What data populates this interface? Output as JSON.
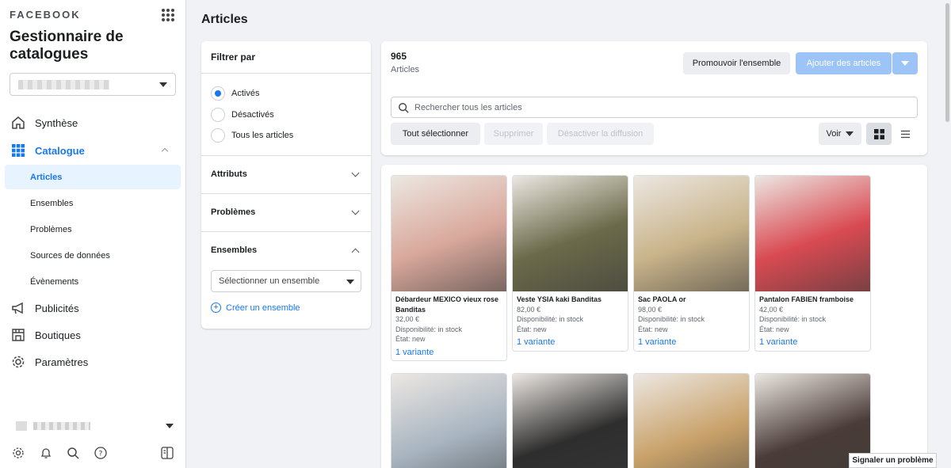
{
  "brand": "FACEBOOK",
  "app_title": "Gestionnaire de catalogues",
  "nav": {
    "synthese": "Synthèse",
    "catalogue": "Catalogue",
    "sub": [
      "Articles",
      "Ensembles",
      "Problèmes",
      "Sources de données",
      "Évènements"
    ],
    "publicites": "Publicités",
    "boutiques": "Boutiques",
    "parametres": "Paramètres"
  },
  "page_title": "Articles",
  "filter": {
    "title": "Filtrer par",
    "options": [
      "Activés",
      "Désactivés",
      "Tous les articles"
    ],
    "selected": "Activés",
    "sections": [
      "Attributs",
      "Problèmes",
      "Ensembles"
    ],
    "ensemble_placeholder": "Sélectionner un ensemble",
    "create_label": "Créer un ensemble"
  },
  "summary": {
    "count": "965",
    "count_label": "Articles",
    "promote": "Promouvoir l'ensemble",
    "add": "Ajouter des articles",
    "search_placeholder": "Rechercher tous les articles",
    "select_all": "Tout sélectionner",
    "delete": "Supprimer",
    "deactivate": "Désactiver la diffusion",
    "view": "Voir"
  },
  "products": [
    {
      "name": "Débardeur MEXICO vieux rose Banditas",
      "price": "32,00 €",
      "availability": "Disponibilité: in stock",
      "condition": "État: new",
      "variant": "1 variante",
      "color": "#d9a89c"
    },
    {
      "name": "Veste YSIA kaki Banditas",
      "price": "82,00 €",
      "availability": "Disponibilité: in stock",
      "condition": "État: new",
      "variant": "1 variante",
      "color": "#6b6a4a"
    },
    {
      "name": "Sac PAOLA or",
      "price": "98,00 €",
      "availability": "Disponibilité: in stock",
      "condition": "État: new",
      "variant": "1 variante",
      "color": "#c9b48a"
    },
    {
      "name": "Pantalon FABIEN framboise",
      "price": "42,00 €",
      "availability": "Disponibilité: in stock",
      "condition": "État: new",
      "variant": "1 variante",
      "color": "#d94a52"
    },
    {
      "color": "#a8b4c0"
    },
    {
      "color": "#2e2e2e"
    },
    {
      "color": "#c9a26a"
    },
    {
      "color": "#4a3c38"
    }
  ],
  "report_label": "Signaler un problème",
  "accent_color": "#1877f2"
}
